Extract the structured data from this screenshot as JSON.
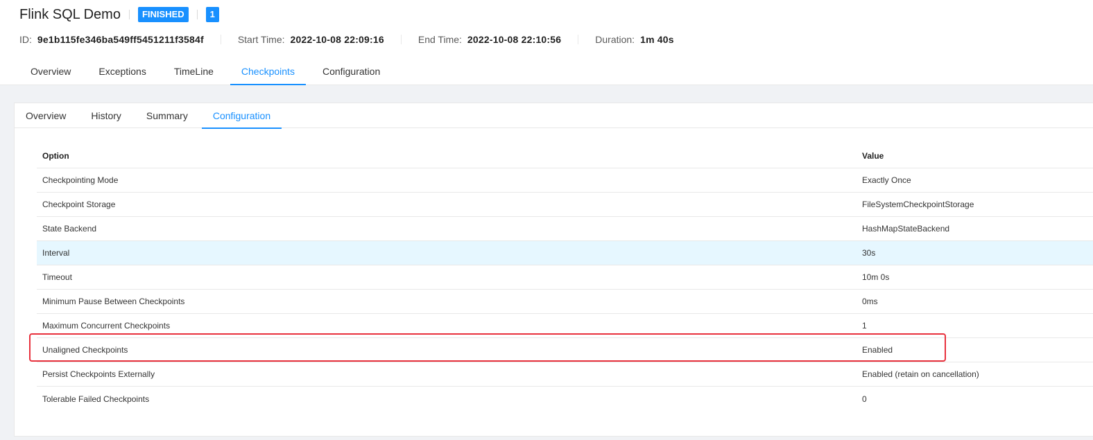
{
  "job": {
    "name": "Flink SQL Demo",
    "status": "FINISHED",
    "parallel_count": "1"
  },
  "meta": {
    "id_label": "ID:",
    "id_value": "9e1b115fe346ba549ff5451211f3584f",
    "start_label": "Start Time:",
    "start_value": "2022-10-08 22:09:16",
    "end_label": "End Time:",
    "end_value": "2022-10-08 22:10:56",
    "duration_label": "Duration:",
    "duration_value": "1m 40s"
  },
  "main_tabs": [
    {
      "label": "Overview"
    },
    {
      "label": "Exceptions"
    },
    {
      "label": "TimeLine"
    },
    {
      "label": "Checkpoints"
    },
    {
      "label": "Configuration"
    }
  ],
  "active_main_tab": "Checkpoints",
  "sub_tabs": [
    {
      "label": "Overview"
    },
    {
      "label": "History"
    },
    {
      "label": "Summary"
    },
    {
      "label": "Configuration"
    }
  ],
  "active_sub_tab": "Configuration",
  "table": {
    "headers": {
      "option": "Option",
      "value": "Value"
    },
    "rows": [
      {
        "option": "Checkpointing Mode",
        "value": "Exactly Once"
      },
      {
        "option": "Checkpoint Storage",
        "value": "FileSystemCheckpointStorage"
      },
      {
        "option": "State Backend",
        "value": "HashMapStateBackend"
      },
      {
        "option": "Interval",
        "value": "30s"
      },
      {
        "option": "Timeout",
        "value": "10m 0s"
      },
      {
        "option": "Minimum Pause Between Checkpoints",
        "value": "0ms"
      },
      {
        "option": "Maximum Concurrent Checkpoints",
        "value": "1"
      },
      {
        "option": "Unaligned Checkpoints",
        "value": "Enabled"
      },
      {
        "option": "Persist Checkpoints Externally",
        "value": "Enabled (retain on cancellation)"
      },
      {
        "option": "Tolerable Failed Checkpoints",
        "value": "0"
      }
    ],
    "highlighted_row": "Interval",
    "annotated_row": "Unaligned Checkpoints"
  },
  "colors": {
    "accent": "#1890ff",
    "row_highlight": "#e6f7ff",
    "annotation": "#e8303c"
  }
}
